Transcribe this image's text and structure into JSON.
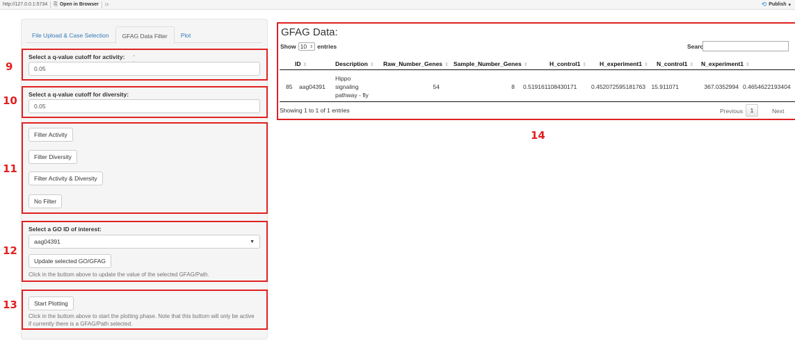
{
  "topbar": {
    "url": "http://127.0.0.1:5734",
    "open_browser": "Open in Browser",
    "publish": "Publish"
  },
  "tabs": [
    {
      "label": "File Upload & Case Selection"
    },
    {
      "label": "GFAG Data Filter"
    },
    {
      "label": "Plot"
    }
  ],
  "activity": {
    "label": "Select a q-value cutoff for activity:",
    "value": "0.05"
  },
  "diversity": {
    "label": "Select a q-value cutoff for diversity:",
    "value": "0.05"
  },
  "filters": {
    "activity": "Filter Activity",
    "diversity": "Filter Diversity",
    "both": "Filter Activity & Diversity",
    "none": "No Filter"
  },
  "go": {
    "label": "Select a GO ID of interest:",
    "selected": "aag04391",
    "update_button": "Update selected GO/GFAG",
    "help": "Click in the buttom above to update the value of the selected GFAG/Path."
  },
  "plotting": {
    "button": "Start Plotting",
    "help_line1": "Click in the buttom above to start the plotting phase. Note that this buttom will only be active",
    "help_line2": "if currently there is a GFAG/Path selected."
  },
  "annotations": [
    "9",
    "10",
    "11",
    "12",
    "13",
    "14"
  ],
  "table": {
    "title": "GFAG Data:",
    "show": "Show",
    "length": "10",
    "entries": "entries",
    "search_label": "Search:",
    "columns": [
      "ID",
      "Description",
      "Raw_Number_Genes",
      "Sample_Number_Genes",
      "H_control1",
      "H_experiment1",
      "N_control1",
      "N_experiment1"
    ],
    "row": {
      "index": "85",
      "id": "aag04391",
      "desc_1": "Hippo",
      "desc_2": "signaling",
      "desc_3": "pathway - fly",
      "raw": "54",
      "sample": "8",
      "h_control": "0.519161108430171",
      "h_experiment": "0.452072595181763",
      "n_control": "15.911071",
      "n_experiment": "367.0352994",
      "extra": "0.4654622193404"
    },
    "info": "Showing 1 to 1 of 1 entries",
    "previous": "Previous",
    "page": "1",
    "next": "Next"
  }
}
